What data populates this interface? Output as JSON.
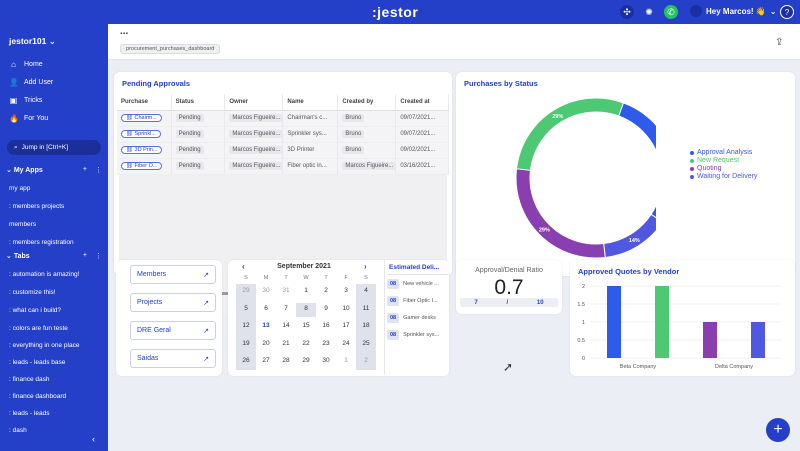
{
  "app": {
    "logo": ":jestor",
    "user": "Hey Marcos! 👋",
    "help": "?"
  },
  "sidebar": {
    "workspace": "jestor101",
    "nav": [
      {
        "label": "Home",
        "icon": "home-icon",
        "glyph": "⌂"
      },
      {
        "label": "Add User",
        "icon": "add-user-icon",
        "glyph": "👤"
      },
      {
        "label": "Tricks",
        "icon": "tricks-icon",
        "glyph": "▣"
      },
      {
        "label": "For You",
        "icon": "for-you-icon",
        "glyph": "🔥"
      }
    ],
    "jump": "Jump in [Ctrl+K]",
    "my_apps_label": "My Apps",
    "apps": [
      "my app",
      ": members projects",
      "members",
      ": members registration"
    ],
    "tabs_label": "Tabs",
    "tabs": [
      ": automation is amazing!",
      ": customize this!",
      ": what can i build?",
      ": colors are fun teste",
      ": everything in one place",
      ": leads - leads base",
      ": finance dash",
      ": finance dashboard",
      ": leads - leads",
      ": dash"
    ]
  },
  "header": {
    "menu": "...",
    "slug": "procurement_purchases_dashboard"
  },
  "pending": {
    "title": "Pending Approvals",
    "columns": [
      "Purchase",
      "Status",
      "Owner",
      "Name",
      "Created by",
      "Created at"
    ],
    "rows": [
      [
        "Chairm...",
        "Pending",
        "Marcos Figueire...",
        "Chairman's c...",
        "Bruno",
        "09/07/2021..."
      ],
      [
        "Sprinkl...",
        "Pending",
        "Marcos Figueire...",
        "Sprinkler sys...",
        "Bruno",
        "09/07/2021..."
      ],
      [
        "3D Prin...",
        "Pending",
        "Marcos Figueire...",
        "3D Printer",
        "Bruno",
        "09/02/2021..."
      ],
      [
        "Fiber O...",
        "Pending",
        "Marcos Figueire...",
        "Fiber optic in...",
        "Marcos Figueire...",
        "03/16/2021..."
      ]
    ]
  },
  "status_chart": {
    "title": "Purchases by Status",
    "legend": [
      "Approval Analysis",
      "New Request",
      "Quoting",
      "Waiting for Delivery"
    ],
    "labels": [
      "29%",
      "29%",
      "29%",
      "14%"
    ],
    "colors": {
      "approval": "#2f5bea",
      "new": "#4cc972",
      "quoting": "#8a3fb0",
      "waiting": "#5058e0"
    }
  },
  "chart_data": [
    {
      "type": "pie",
      "title": "Purchases by Status",
      "categories": [
        "Approval Analysis",
        "New Request",
        "Quoting",
        "Waiting for Delivery"
      ],
      "values": [
        29,
        29,
        29,
        14
      ]
    },
    {
      "type": "bar",
      "title": "Approved Quotes by Vendor",
      "categories": [
        "",
        "Beta Company",
        "",
        "Delta Company"
      ],
      "values": [
        2,
        2,
        1,
        1
      ],
      "ylim": [
        0,
        2
      ],
      "yticks": [
        "0",
        "0.5",
        "1",
        "1.5",
        "2"
      ]
    }
  ],
  "links": [
    "Members",
    "Projects",
    "DRE Geral",
    "Saidas"
  ],
  "calendar": {
    "month": "September 2021",
    "prev": "‹",
    "next": "›",
    "dow": [
      "S",
      "M",
      "T",
      "W",
      "T",
      "F",
      "S"
    ],
    "weeks": [
      [
        "29",
        "30",
        "31",
        "1",
        "2",
        "3",
        "4"
      ],
      [
        "5",
        "6",
        "7",
        "8",
        "9",
        "10",
        "11"
      ],
      [
        "12",
        "13",
        "14",
        "15",
        "16",
        "17",
        "18"
      ],
      [
        "19",
        "20",
        "21",
        "22",
        "23",
        "24",
        "25"
      ],
      [
        "26",
        "27",
        "28",
        "29",
        "30",
        "1",
        "2"
      ]
    ]
  },
  "estimated": {
    "title": "Estimated Deli...",
    "rows": [
      [
        "08",
        "New vehicle ..."
      ],
      [
        "08",
        "Fiber Optic I..."
      ],
      [
        "08",
        "Gamer desks"
      ],
      [
        "08",
        "Sprinkler sys..."
      ]
    ]
  },
  "ratio": {
    "title": "Approval/Denial Ratio",
    "value": "0.7",
    "approved": "7",
    "sep": "/",
    "total": "10"
  },
  "vendors_chart": {
    "title": "Approved Quotes by Vendor",
    "colors": [
      "#2f5bea",
      "#4cc972",
      "#8a3fb0",
      "#5058e0"
    ]
  },
  "fab": "+"
}
